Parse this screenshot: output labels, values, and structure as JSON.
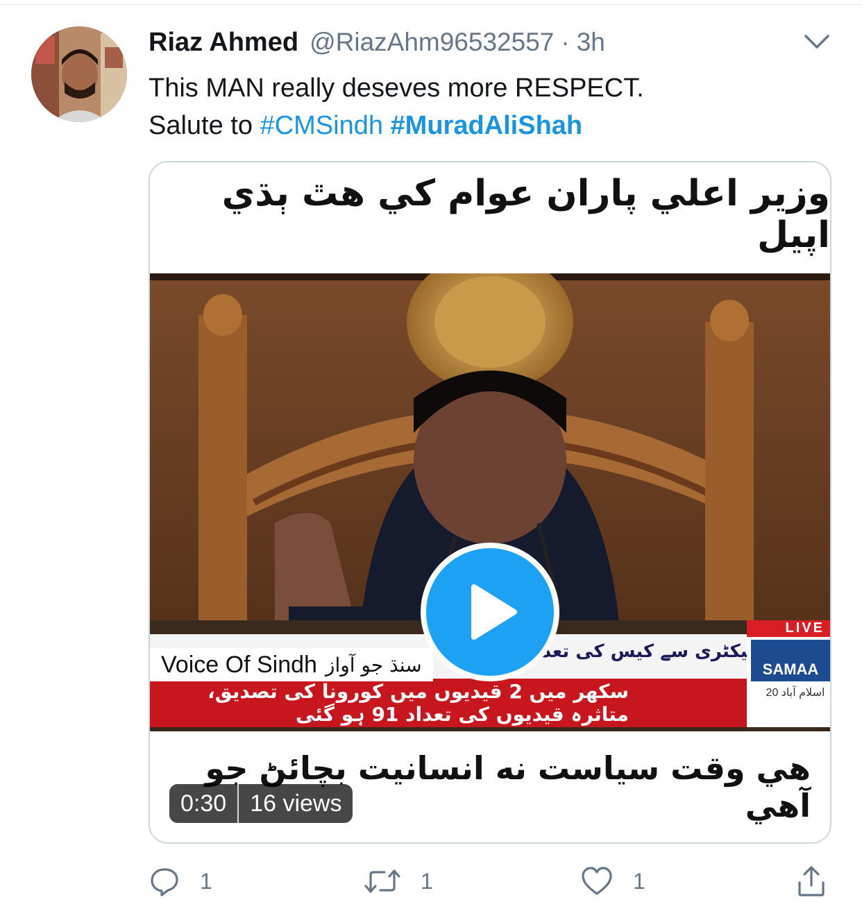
{
  "tweet": {
    "author_name": "Riaz Ahmed",
    "handle": "@RiazAhm96532557",
    "separator": "·",
    "time": "3h",
    "text_line1": "This MAN really deseves more RESPECT.",
    "text_line2_prefix": "Salute to ",
    "hashtag1": "#CMSindh",
    "hashtag2": "#MuradAliShah"
  },
  "media": {
    "top_caption": "وزير اعلي پاران عوام کي هٿ ٻڌي اپيل",
    "bottom_caption": "هي وقت سياست نه انسانيت بچائڻ جو آهي",
    "ticker_top": "کسی فیکٹری سے کیس کی تعداد فیکٹری",
    "ticker_bottom": "سکھر میں 2 قیدیوں میں کورونا کی تصدیق، متاثرہ قیدیوں کی تعداد 91 ہو گئی",
    "watermark_en": "Voice Of Sindh",
    "watermark_ur": "سنڌ جو آواز",
    "channel_live": "LIVE",
    "channel_name": "SAMAA",
    "channel_sub": "اسلام آباد 20",
    "duration": "0:30",
    "views": "16 views"
  },
  "actions": {
    "reply_count": "1",
    "retweet_count": "1",
    "like_count": "1"
  },
  "colors": {
    "link": "#1b95e0",
    "play": "#1da1f2",
    "muted": "#657786",
    "ticker_red": "#c8161f"
  }
}
